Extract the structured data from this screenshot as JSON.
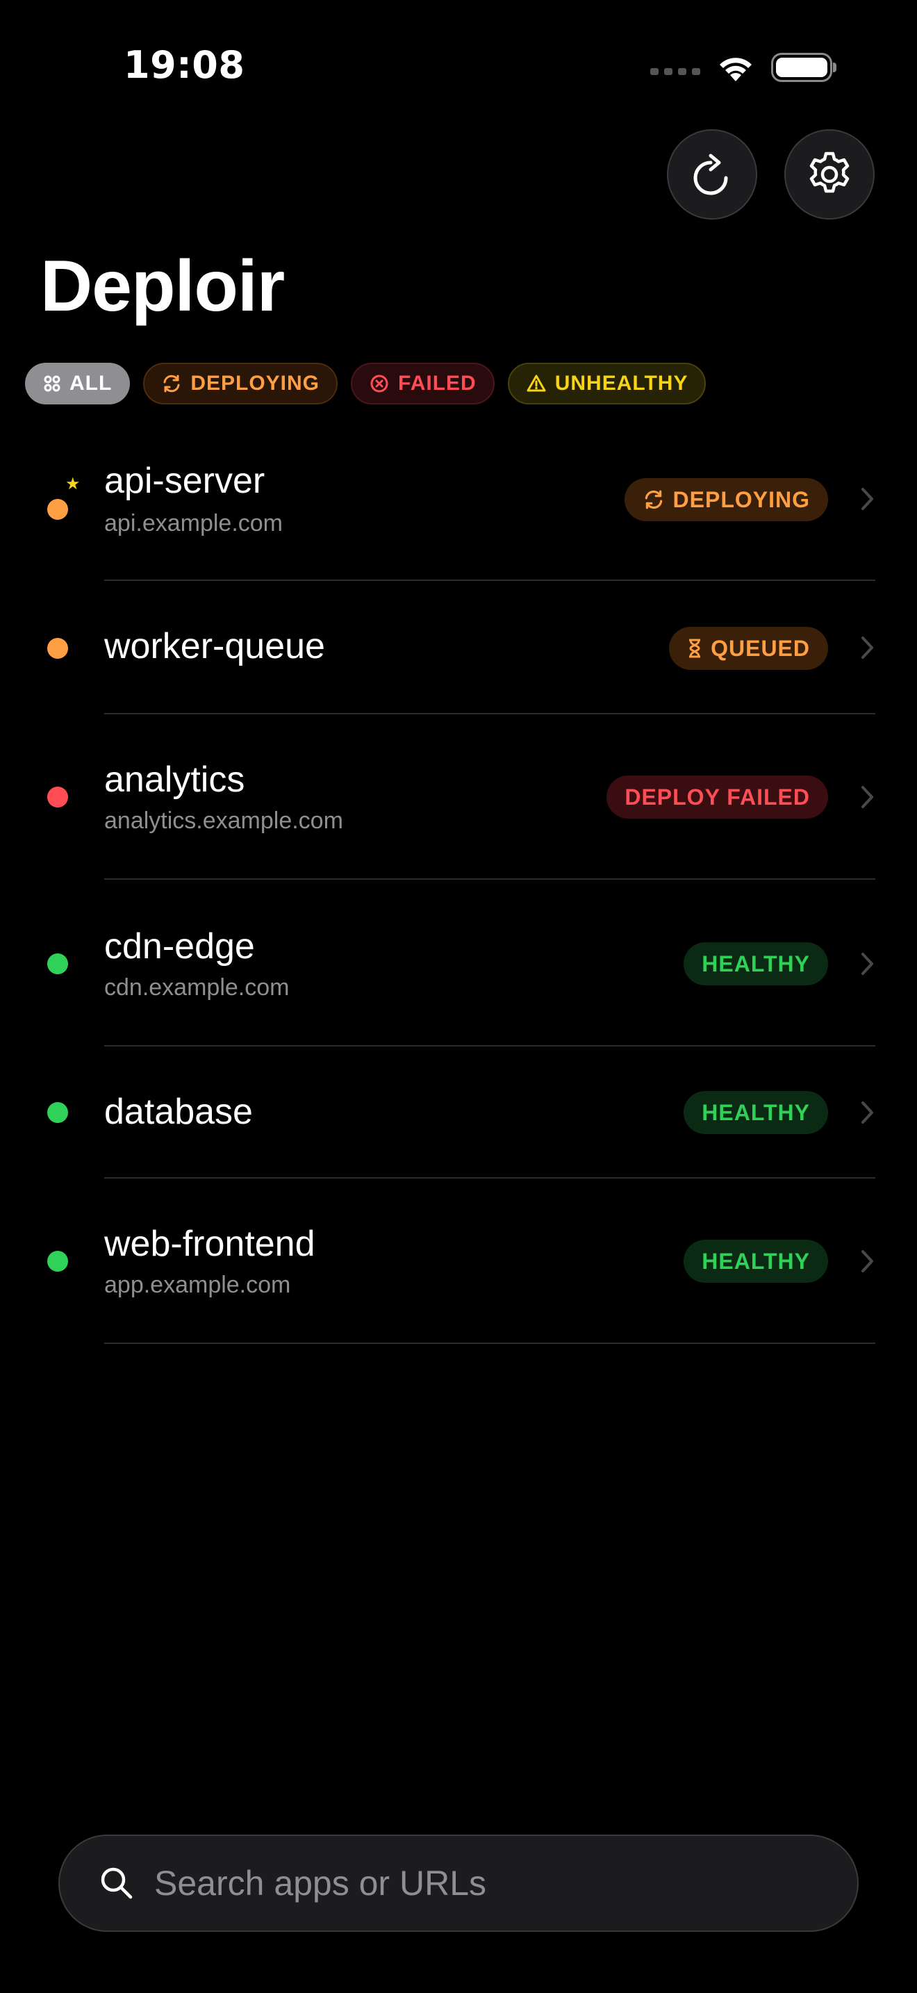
{
  "status_bar": {
    "time": "19:08"
  },
  "header": {
    "title": "Deploir",
    "refresh_icon": "refresh-icon",
    "settings_icon": "gear-icon"
  },
  "filters": [
    {
      "label": "ALL",
      "icon": "grid-icon",
      "active": true
    },
    {
      "label": "DEPLOYING",
      "icon": "sync-icon",
      "color": "#ff9f43"
    },
    {
      "label": "FAILED",
      "icon": "x-circle-icon",
      "color": "#ff4d55"
    },
    {
      "label": "UNHEALTHY",
      "icon": "warning-icon",
      "color": "#f7d417"
    }
  ],
  "apps": [
    {
      "name": "api-server",
      "url": "api.example.com",
      "status": "DEPLOYING",
      "dot_color": "#ff9f43",
      "starred": true,
      "badge_icon": "sync-icon"
    },
    {
      "name": "worker-queue",
      "url": "",
      "status": "QUEUED",
      "dot_color": "#ff9f43",
      "badge_icon": "hourglass-icon"
    },
    {
      "name": "analytics",
      "url": "analytics.example.com",
      "status": "DEPLOY FAILED",
      "dot_color": "#ff4d55"
    },
    {
      "name": "cdn-edge",
      "url": "cdn.example.com",
      "status": "HEALTHY",
      "dot_color": "#30d158"
    },
    {
      "name": "database",
      "url": "",
      "status": "HEALTHY",
      "dot_color": "#30d158"
    },
    {
      "name": "web-frontend",
      "url": "app.example.com",
      "status": "HEALTHY",
      "dot_color": "#30d158"
    }
  ],
  "search": {
    "placeholder": "Search apps or URLs"
  }
}
